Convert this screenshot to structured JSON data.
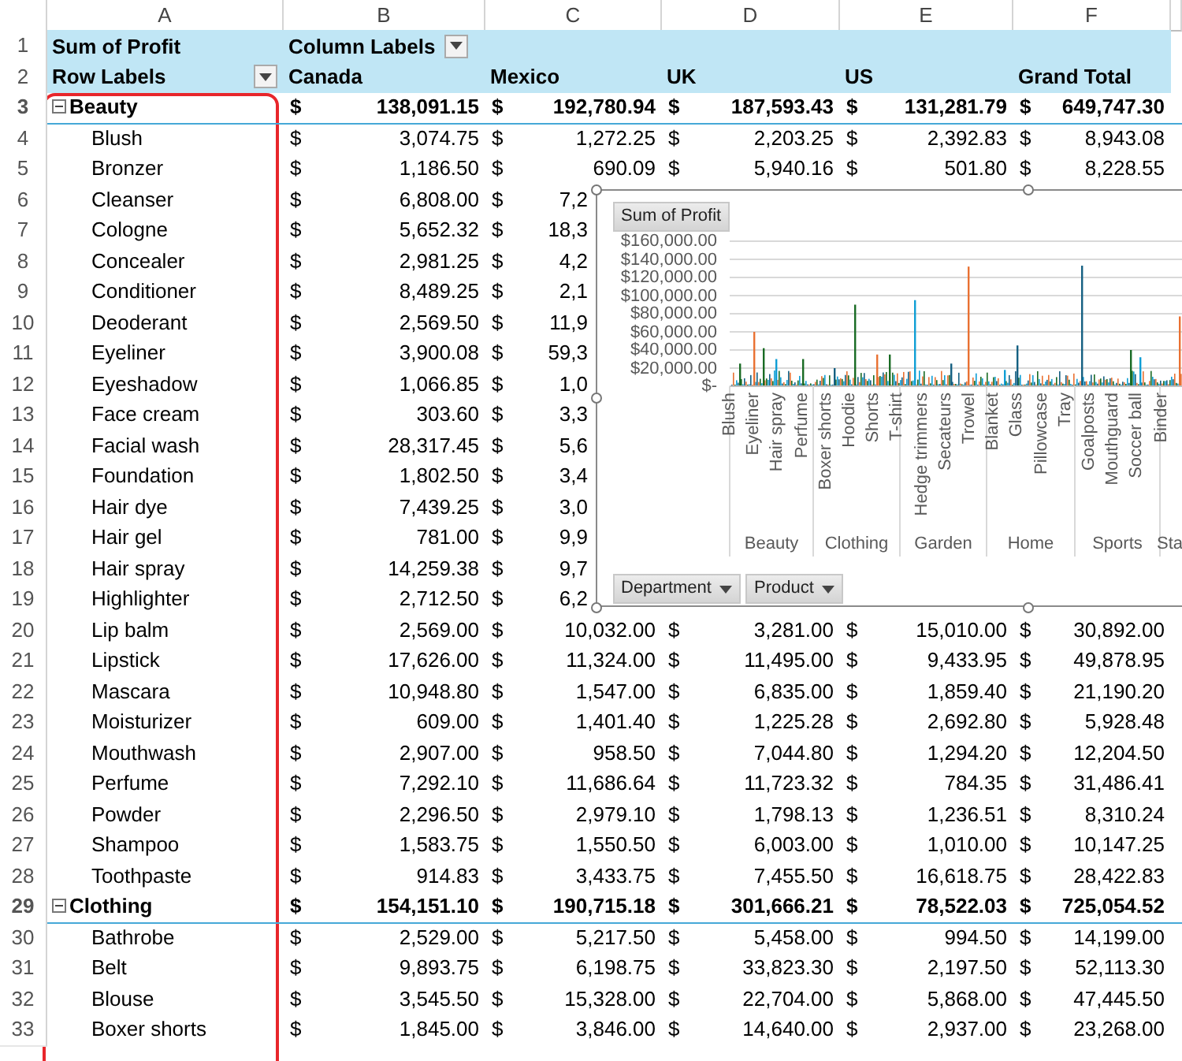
{
  "columns": [
    "A",
    "B",
    "C",
    "D",
    "E",
    "F"
  ],
  "pivot": {
    "title": "Sum of Profit",
    "column_labels": "Column Labels",
    "row_labels": "Row Labels",
    "header_row_numbers": [
      "1",
      "2"
    ],
    "headers": [
      "Canada",
      "Mexico",
      "UK",
      "US",
      "Grand Total"
    ]
  },
  "rows": [
    {
      "number": "3",
      "kind": "group",
      "expanded": true,
      "label": "Beauty",
      "cells": [
        [
          "$",
          "138,091.15"
        ],
        [
          "$",
          "192,780.94"
        ],
        [
          "$",
          "187,593.43"
        ],
        [
          "$",
          "131,281.79"
        ],
        [
          "$",
          "649,747.30"
        ]
      ]
    },
    {
      "number": "4",
      "kind": "item",
      "label": "Blush",
      "cells": [
        [
          "$",
          "3,074.75"
        ],
        [
          "$",
          "1,272.25"
        ],
        [
          "$",
          "2,203.25"
        ],
        [
          "$",
          "2,392.83"
        ],
        [
          "$",
          "8,943.08"
        ]
      ]
    },
    {
      "number": "5",
      "kind": "item",
      "label": "Bronzer",
      "cells": [
        [
          "$",
          "1,186.50"
        ],
        [
          "$",
          "690.09"
        ],
        [
          "$",
          "5,940.16"
        ],
        [
          "$",
          "501.80"
        ],
        [
          "$",
          "8,228.55"
        ]
      ]
    },
    {
      "number": "6",
      "kind": "item",
      "label": "Cleanser",
      "cells": [
        [
          "$",
          "6,808.00"
        ],
        [
          "$",
          "7,2"
        ]
      ]
    },
    {
      "number": "7",
      "kind": "item",
      "label": "Cologne",
      "cells": [
        [
          "$",
          "5,652.32"
        ],
        [
          "$",
          "18,3"
        ]
      ]
    },
    {
      "number": "8",
      "kind": "item",
      "label": "Concealer",
      "cells": [
        [
          "$",
          "2,981.25"
        ],
        [
          "$",
          "4,2"
        ]
      ]
    },
    {
      "number": "9",
      "kind": "item",
      "label": "Conditioner",
      "cells": [
        [
          "$",
          "8,489.25"
        ],
        [
          "$",
          "2,1"
        ]
      ]
    },
    {
      "number": "10",
      "kind": "item",
      "label": "Deoderant",
      "cells": [
        [
          "$",
          "2,569.50"
        ],
        [
          "$",
          "11,9"
        ]
      ]
    },
    {
      "number": "11",
      "kind": "item",
      "label": "Eyeliner",
      "cells": [
        [
          "$",
          "3,900.08"
        ],
        [
          "$",
          "59,3"
        ]
      ]
    },
    {
      "number": "12",
      "kind": "item",
      "label": "Eyeshadow",
      "cells": [
        [
          "$",
          "1,066.85"
        ],
        [
          "$",
          "1,0"
        ]
      ]
    },
    {
      "number": "13",
      "kind": "item",
      "label": "Face cream",
      "cells": [
        [
          "$",
          "303.60"
        ],
        [
          "$",
          "3,3"
        ]
      ]
    },
    {
      "number": "14",
      "kind": "item",
      "label": "Facial wash",
      "cells": [
        [
          "$",
          "28,317.45"
        ],
        [
          "$",
          "5,6"
        ]
      ]
    },
    {
      "number": "15",
      "kind": "item",
      "label": "Foundation",
      "cells": [
        [
          "$",
          "1,802.50"
        ],
        [
          "$",
          "3,4"
        ]
      ]
    },
    {
      "number": "16",
      "kind": "item",
      "label": "Hair dye",
      "cells": [
        [
          "$",
          "7,439.25"
        ],
        [
          "$",
          "3,0"
        ]
      ]
    },
    {
      "number": "17",
      "kind": "item",
      "label": "Hair gel",
      "cells": [
        [
          "$",
          "781.00"
        ],
        [
          "$",
          "9,9"
        ]
      ]
    },
    {
      "number": "18",
      "kind": "item",
      "label": "Hair spray",
      "cells": [
        [
          "$",
          "14,259.38"
        ],
        [
          "$",
          "9,7"
        ]
      ]
    },
    {
      "number": "19",
      "kind": "item",
      "label": "Highlighter",
      "cells": [
        [
          "$",
          "2,712.50"
        ],
        [
          "$",
          "6,2"
        ]
      ]
    },
    {
      "number": "20",
      "kind": "item",
      "label": "Lip balm",
      "cells": [
        [
          "$",
          "2,569.00"
        ],
        [
          "$",
          "10,032.00"
        ],
        [
          "$",
          "3,281.00"
        ],
        [
          "$",
          "15,010.00"
        ],
        [
          "$",
          "30,892.00"
        ]
      ]
    },
    {
      "number": "21",
      "kind": "item",
      "label": "Lipstick",
      "cells": [
        [
          "$",
          "17,626.00"
        ],
        [
          "$",
          "11,324.00"
        ],
        [
          "$",
          "11,495.00"
        ],
        [
          "$",
          "9,433.95"
        ],
        [
          "$",
          "49,878.95"
        ]
      ]
    },
    {
      "number": "22",
      "kind": "item",
      "label": "Mascara",
      "cells": [
        [
          "$",
          "10,948.80"
        ],
        [
          "$",
          "1,547.00"
        ],
        [
          "$",
          "6,835.00"
        ],
        [
          "$",
          "1,859.40"
        ],
        [
          "$",
          "21,190.20"
        ]
      ]
    },
    {
      "number": "23",
      "kind": "item",
      "label": "Moisturizer",
      "cells": [
        [
          "$",
          "609.00"
        ],
        [
          "$",
          "1,401.40"
        ],
        [
          "$",
          "1,225.28"
        ],
        [
          "$",
          "2,692.80"
        ],
        [
          "$",
          "5,928.48"
        ]
      ]
    },
    {
      "number": "24",
      "kind": "item",
      "label": "Mouthwash",
      "cells": [
        [
          "$",
          "2,907.00"
        ],
        [
          "$",
          "958.50"
        ],
        [
          "$",
          "7,044.80"
        ],
        [
          "$",
          "1,294.20"
        ],
        [
          "$",
          "12,204.50"
        ]
      ]
    },
    {
      "number": "25",
      "kind": "item",
      "label": "Perfume",
      "cells": [
        [
          "$",
          "7,292.10"
        ],
        [
          "$",
          "11,686.64"
        ],
        [
          "$",
          "11,723.32"
        ],
        [
          "$",
          "784.35"
        ],
        [
          "$",
          "31,486.41"
        ]
      ]
    },
    {
      "number": "26",
      "kind": "item",
      "label": "Powder",
      "cells": [
        [
          "$",
          "2,296.50"
        ],
        [
          "$",
          "2,979.10"
        ],
        [
          "$",
          "1,798.13"
        ],
        [
          "$",
          "1,236.51"
        ],
        [
          "$",
          "8,310.24"
        ]
      ]
    },
    {
      "number": "27",
      "kind": "item",
      "label": "Shampoo",
      "cells": [
        [
          "$",
          "1,583.75"
        ],
        [
          "$",
          "1,550.50"
        ],
        [
          "$",
          "6,003.00"
        ],
        [
          "$",
          "1,010.00"
        ],
        [
          "$",
          "10,147.25"
        ]
      ]
    },
    {
      "number": "28",
      "kind": "item",
      "label": "Toothpaste",
      "cells": [
        [
          "$",
          "914.83"
        ],
        [
          "$",
          "3,433.75"
        ],
        [
          "$",
          "7,455.50"
        ],
        [
          "$",
          "16,618.75"
        ],
        [
          "$",
          "28,422.83"
        ]
      ]
    },
    {
      "number": "29",
      "kind": "group",
      "expanded": true,
      "label": "Clothing",
      "cells": [
        [
          "$",
          "154,151.10"
        ],
        [
          "$",
          "190,715.18"
        ],
        [
          "$",
          "301,666.21"
        ],
        [
          "$",
          "78,522.03"
        ],
        [
          "$",
          "725,054.52"
        ]
      ]
    },
    {
      "number": "30",
      "kind": "item",
      "label": "Bathrobe",
      "cells": [
        [
          "$",
          "2,529.00"
        ],
        [
          "$",
          "5,217.50"
        ],
        [
          "$",
          "5,458.00"
        ],
        [
          "$",
          "994.50"
        ],
        [
          "$",
          "14,199.00"
        ]
      ]
    },
    {
      "number": "31",
      "kind": "item",
      "label": "Belt",
      "cells": [
        [
          "$",
          "9,893.75"
        ],
        [
          "$",
          "6,198.75"
        ],
        [
          "$",
          "33,823.30"
        ],
        [
          "$",
          "2,197.50"
        ],
        [
          "$",
          "52,113.30"
        ]
      ]
    },
    {
      "number": "32",
      "kind": "item",
      "label": "Blouse",
      "cells": [
        [
          "$",
          "3,545.50"
        ],
        [
          "$",
          "15,328.00"
        ],
        [
          "$",
          "22,704.00"
        ],
        [
          "$",
          "5,868.00"
        ],
        [
          "$",
          "47,445.50"
        ]
      ]
    },
    {
      "number": "33",
      "kind": "item",
      "label": "Boxer shorts",
      "cells": [
        [
          "$",
          "1,845.00"
        ],
        [
          "$",
          "3,846.00"
        ],
        [
          "$",
          "14,640.00"
        ],
        [
          "$",
          "2,937.00"
        ],
        [
          "$",
          "23,268.00"
        ]
      ]
    }
  ],
  "chart": {
    "value_button": "Sum of Profit",
    "y_axis_labels": [
      "$160,000.00",
      "$140,000.00",
      "$120,000.00",
      "$100,000.00",
      "$80,000.00",
      "$60,000.00",
      "$40,000.00",
      "$20,000.00",
      "$-"
    ],
    "x_labels": [
      "Blush",
      "Eyeliner",
      "Hair spray",
      "Perfume",
      "Boxer shorts",
      "Hoodie",
      "Shorts",
      "T-shirt",
      "Hedge trimmers",
      "Secateurs",
      "Trowel",
      "Blanket",
      "Glass",
      "Pillowcase",
      "Tray",
      "Goalposts",
      "Mouthguard",
      "Soccer ball",
      "Binder"
    ],
    "groups": [
      "Beauty",
      "Clothing",
      "Garden",
      "Home",
      "Sports",
      "Sta"
    ],
    "field_buttons": [
      "Department",
      "Product"
    ]
  }
}
